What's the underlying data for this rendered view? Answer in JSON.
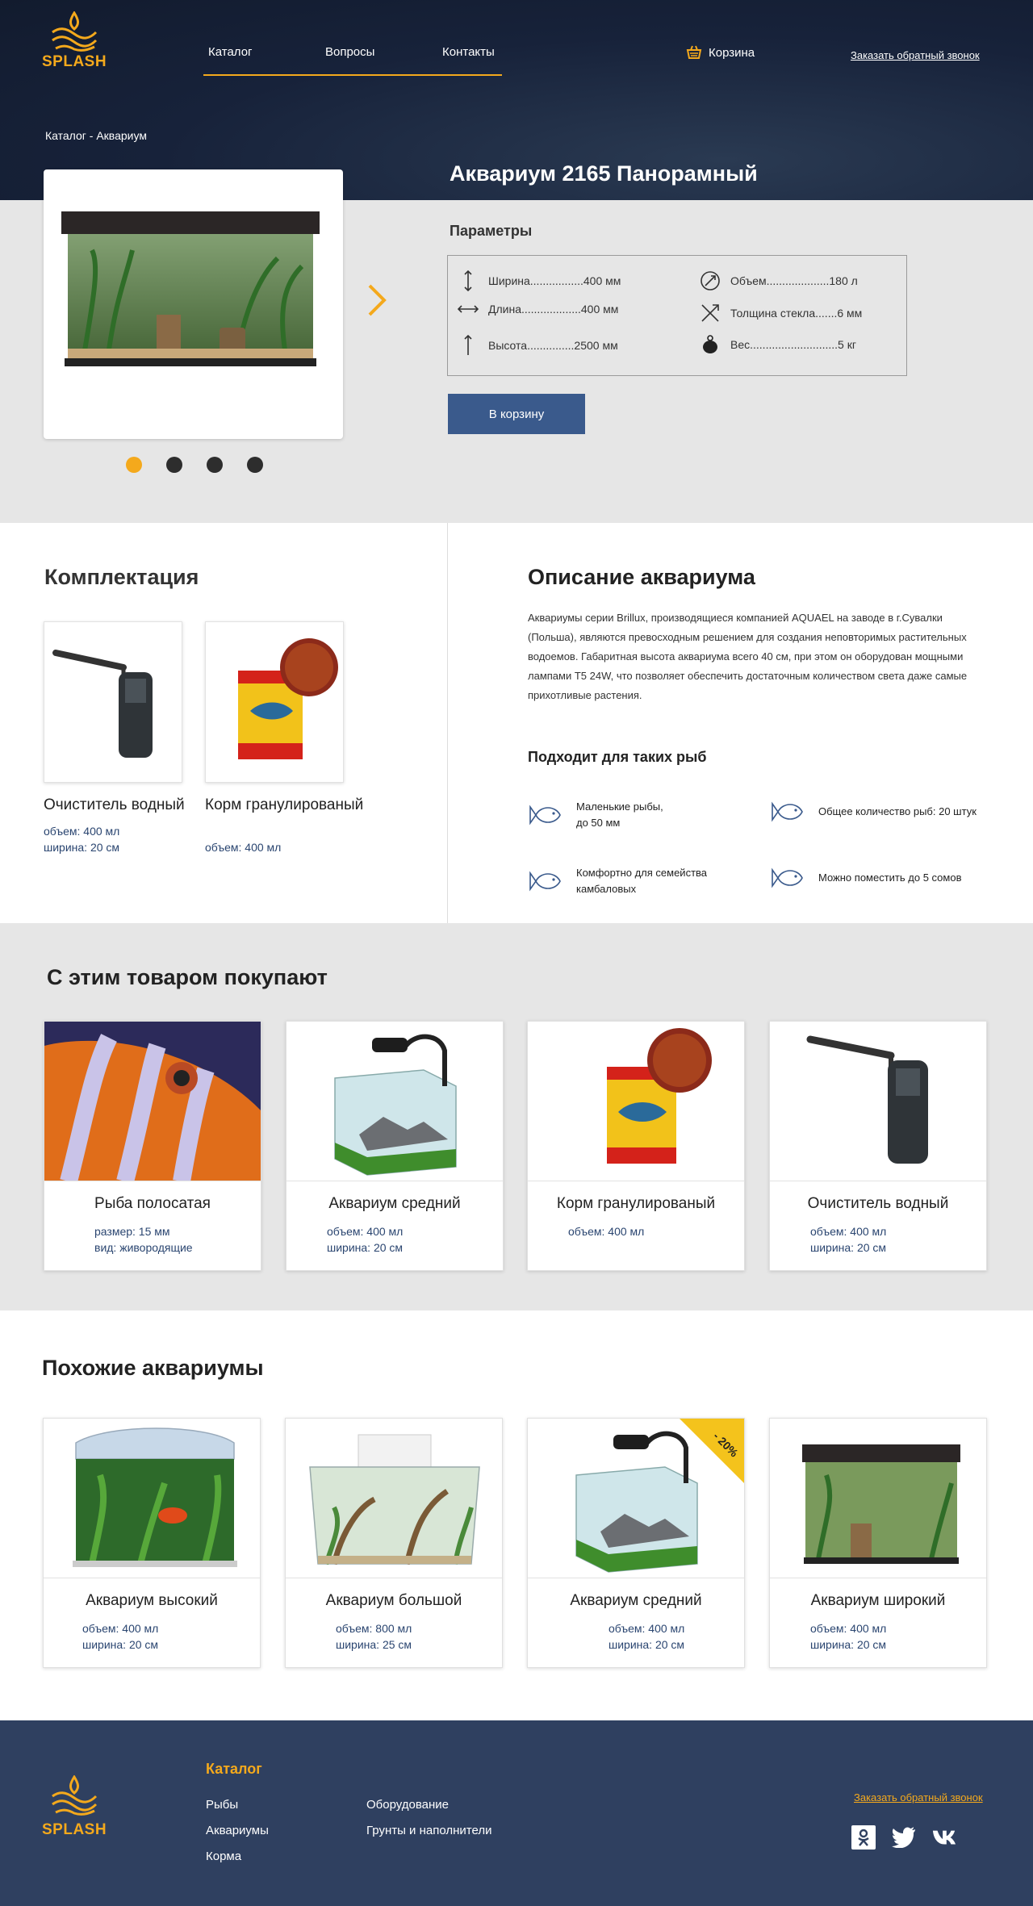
{
  "brand": {
    "name": "SPLASH",
    "accent": "#f4a91c",
    "navy": "#17223a",
    "blue_button": "#3a5a8c",
    "footer_bg": "#2f4060"
  },
  "nav": {
    "items": [
      "Каталог",
      "Вопросы",
      "Контакты"
    ]
  },
  "header": {
    "cart_label": "Корзина",
    "callback_label": "Заказать обратный звонок"
  },
  "breadcrumb": "Каталог - Аквариум",
  "product": {
    "title": "Аквариум 2165 Панорамный",
    "params_title": "Параметры",
    "params": [
      {
        "icon": "height-arrows-icon",
        "text": "Ширина.................400 мм"
      },
      {
        "icon": "volume-icon",
        "text": "Объем....................180 л"
      },
      {
        "icon": "width-arrows-icon",
        "text": "Длина...................400 мм"
      },
      {
        "icon": "glass-thickness-icon",
        "text": "Толщина стекла.......6 мм"
      },
      {
        "icon": "height-arrow-icon",
        "text": "Высота...............2500 мм"
      },
      {
        "icon": "weight-icon",
        "text": "Вес............................5 кг"
      }
    ],
    "cart_button": "В корзину",
    "slides": 4,
    "active_slide": 1
  },
  "kit": {
    "title": "Комплектация",
    "items": [
      {
        "name": "Очиститель водный",
        "specs": [
          "объем: 400 мл",
          "ширина: 20 см"
        ]
      },
      {
        "name": "Корм гранулированый",
        "specs": [
          "объем: 400 мл"
        ]
      }
    ]
  },
  "description": {
    "title": "Описание аквариума",
    "text": "Аквариумы серии Brillux, производящиеся компанией AQUAEL  на заводе в г.Сувалки (Польша), являются превосходным решением для создания неповторимых растительных водоемов. Габаритная высота аквариума всего 40 см, при этом он оборудован мощными лампами T5 24W, что позволяет обеспечить достаточным количеством света даже самые прихотливые растения.",
    "fish_title": "Подходит для таких рыб",
    "features": [
      "Маленькие рыбы, до 50 мм",
      "Общее количество рыб: 20 штук",
      "Комфортно для семейства камбаловых",
      "Можно поместить до 5 сомов"
    ]
  },
  "also_buy": {
    "title": "С этим товаром покупают",
    "items": [
      {
        "name": "Рыба полосатая",
        "specs": [
          "размер: 15 мм",
          "вид: живородящие"
        ]
      },
      {
        "name": "Аквариум средний",
        "specs": [
          "объем: 400 мл",
          "ширина: 20 см"
        ]
      },
      {
        "name": "Корм гранулированый",
        "specs": [
          "объем: 400 мл"
        ]
      },
      {
        "name": "Очиститель водный",
        "specs": [
          "объем: 400 мл",
          "ширина: 20 см"
        ]
      }
    ]
  },
  "similar": {
    "title": "Похожие аквариумы",
    "items": [
      {
        "name": "Аквариум высокий",
        "specs": [
          "объем: 400 мл",
          "ширина: 20 см"
        ]
      },
      {
        "name": "Аквариум большой",
        "specs": [
          "объем: 800 мл",
          "ширина: 25 см"
        ]
      },
      {
        "name": "Аквариум средний",
        "specs": [
          "объем: 400 мл",
          "ширина: 20 см"
        ],
        "badge": "- 20%"
      },
      {
        "name": "Аквариум широкий",
        "specs": [
          "объем: 400 мл",
          "ширина: 20 см"
        ]
      }
    ]
  },
  "footer": {
    "catalog_title": "Каталог",
    "links": [
      "Рыбы",
      "Аквариумы",
      "Корма",
      "Оборудование",
      "Грунты и наполнители"
    ],
    "callback_label": "Заказать обратный звонок",
    "social": [
      "odnoklassniki-icon",
      "twitter-icon",
      "vk-icon"
    ]
  }
}
